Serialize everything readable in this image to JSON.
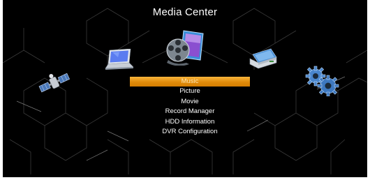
{
  "title": "Media Center",
  "menu": {
    "selected_index": 0,
    "items": [
      "Music",
      "Picture",
      "Movie",
      "Record Manager",
      "HDD Information",
      "DVR Configuration"
    ]
  },
  "icons": {
    "far_left": "satellite-icon",
    "left": "laptop-icon",
    "center": "film-reel-media-icon",
    "right": "scanner-icon",
    "far_right": "gears-icon"
  },
  "colors": {
    "background": "#000000",
    "highlight": "#e08b0a",
    "text": "#ffffff",
    "hex_lines": "#3a3a3a"
  }
}
